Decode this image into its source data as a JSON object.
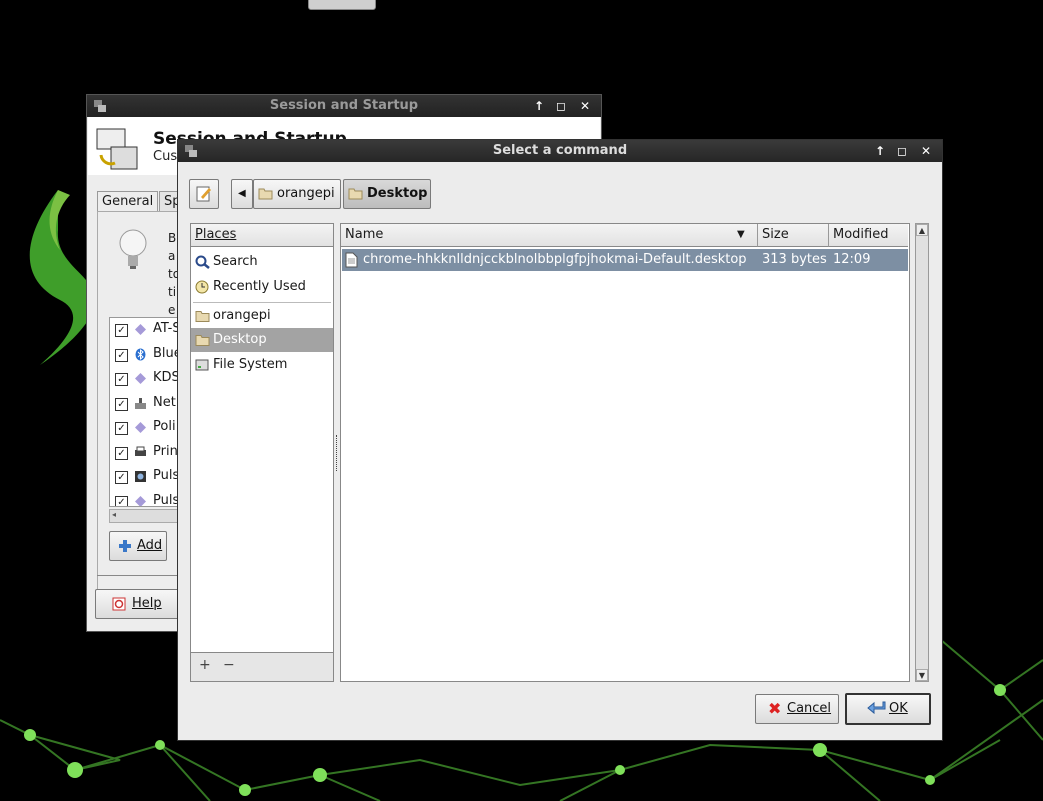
{
  "back_window": {
    "title": "Session and Startup",
    "header_title": "Session and Startup",
    "header_subtitle": "Cus",
    "tabs": [
      "General",
      "Sp"
    ],
    "description_lines": [
      "B",
      "a",
      "to",
      "ti",
      "e"
    ],
    "autostart_items": [
      {
        "label": "AT-S",
        "icon": "diamond-icon"
      },
      {
        "label": "Blue",
        "icon": "bluetooth-icon"
      },
      {
        "label": "KDS",
        "icon": "diamond-icon"
      },
      {
        "label": "Net",
        "icon": "network-icon"
      },
      {
        "label": "Poli",
        "icon": "diamond-icon"
      },
      {
        "label": "Prin",
        "icon": "printer-icon"
      },
      {
        "label": "Puls",
        "icon": "speaker-icon"
      },
      {
        "label": "Puls",
        "icon": "diamond-icon"
      }
    ],
    "add_button": "Add",
    "help_button": "Help"
  },
  "dialog": {
    "title": "Select a command",
    "path": [
      "orangepi",
      "Desktop"
    ],
    "places_header": "Places",
    "places": [
      {
        "label": "Search",
        "icon": "search-icon"
      },
      {
        "label": "Recently Used",
        "icon": "clock-icon"
      },
      {
        "label": "orangepi",
        "icon": "folder-icon"
      },
      {
        "label": "Desktop",
        "icon": "folder-icon",
        "selected": true
      },
      {
        "label": "File System",
        "icon": "drive-icon"
      }
    ],
    "columns": {
      "name": "Name",
      "size": "Size",
      "modified": "Modified"
    },
    "files": [
      {
        "name": "chrome-hhkknlldnjcckblnolbbplgfpjhokmai-Default.desktop",
        "size": "313 bytes",
        "modified": "12:09",
        "selected": true
      }
    ],
    "places_add": "+",
    "places_remove": "−",
    "cancel_button": "Cancel",
    "ok_button": "OK"
  },
  "colors": {
    "selection": "#7d8fa3",
    "place_selected": "#a3a3a3",
    "title_bar": "#2a2a2a",
    "desktop_green": "#3f9e2a"
  }
}
